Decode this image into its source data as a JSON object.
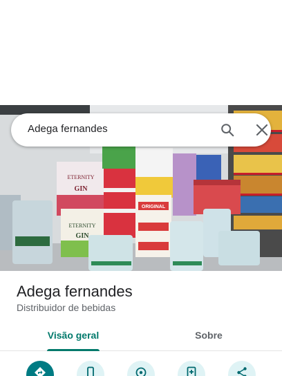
{
  "search": {
    "query": "Adega fernandes"
  },
  "place": {
    "name": "Adega fernandes",
    "category": "Distribuidor de bebidas"
  },
  "photo": {
    "box_brand": "ETERNITY",
    "box_product": "GIN",
    "cooler_brand": "ORIGINAL"
  },
  "tabs": [
    {
      "label": "Visão geral",
      "active": true
    },
    {
      "label": "Sobre",
      "active": false
    }
  ],
  "actions": [
    {
      "icon": "directions-icon",
      "primary": true
    },
    {
      "icon": "phone-icon",
      "primary": false
    },
    {
      "icon": "nearby-icon",
      "primary": false
    },
    {
      "icon": "save-icon",
      "primary": false
    },
    {
      "icon": "share-icon",
      "primary": false
    }
  ],
  "colors": {
    "accent": "#00796b",
    "primary_action": "#007b83",
    "action_bg": "#dff3f5"
  }
}
